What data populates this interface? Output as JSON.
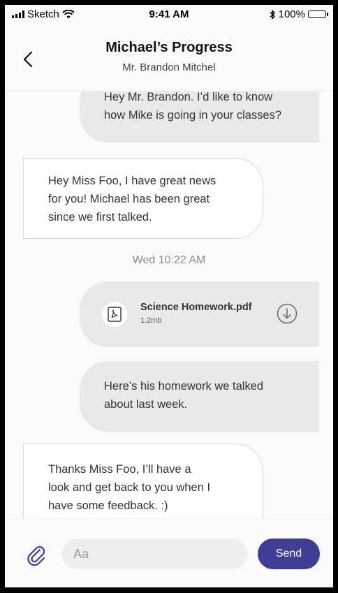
{
  "status_bar": {
    "carrier": "Sketch",
    "time": "9:41 AM",
    "battery": "100%"
  },
  "header": {
    "title": "Michael’s Progress",
    "subtitle": "Mr. Brandon Mitchel"
  },
  "messages": [
    {
      "direction": "out",
      "lines": [
        "Hey Mr. Brandon. I’d like to know",
        "how Mike is going in your classes?"
      ]
    },
    {
      "direction": "in",
      "lines": [
        "Hey Miss Foo, I have great news",
        "for you! Michael has been great",
        "since we first talked."
      ]
    },
    {
      "timestamp": "Wed 10:22 AM"
    },
    {
      "direction": "out",
      "file": {
        "name": "Science Homework.pdf",
        "size": "1.2mb"
      }
    },
    {
      "direction": "out",
      "lines": [
        "Here’s his homework we talked",
        "about last week."
      ]
    },
    {
      "direction": "in",
      "lines": [
        "Thanks Miss Foo, I’ll have a",
        "look and get back to you when I",
        "have some feedback. :)"
      ]
    }
  ],
  "composer": {
    "placeholder": "Aa",
    "send_label": "Send"
  },
  "colors": {
    "accent": "#3f3d94",
    "out_bubble": "#e9e9e9",
    "in_bubble": "#ffffff",
    "timestamp": "#8c8c8c"
  },
  "icons": {
    "back": "chevron-left-icon",
    "file": "pdf-file-icon",
    "download": "download-icon",
    "attach": "paperclip-icon"
  }
}
